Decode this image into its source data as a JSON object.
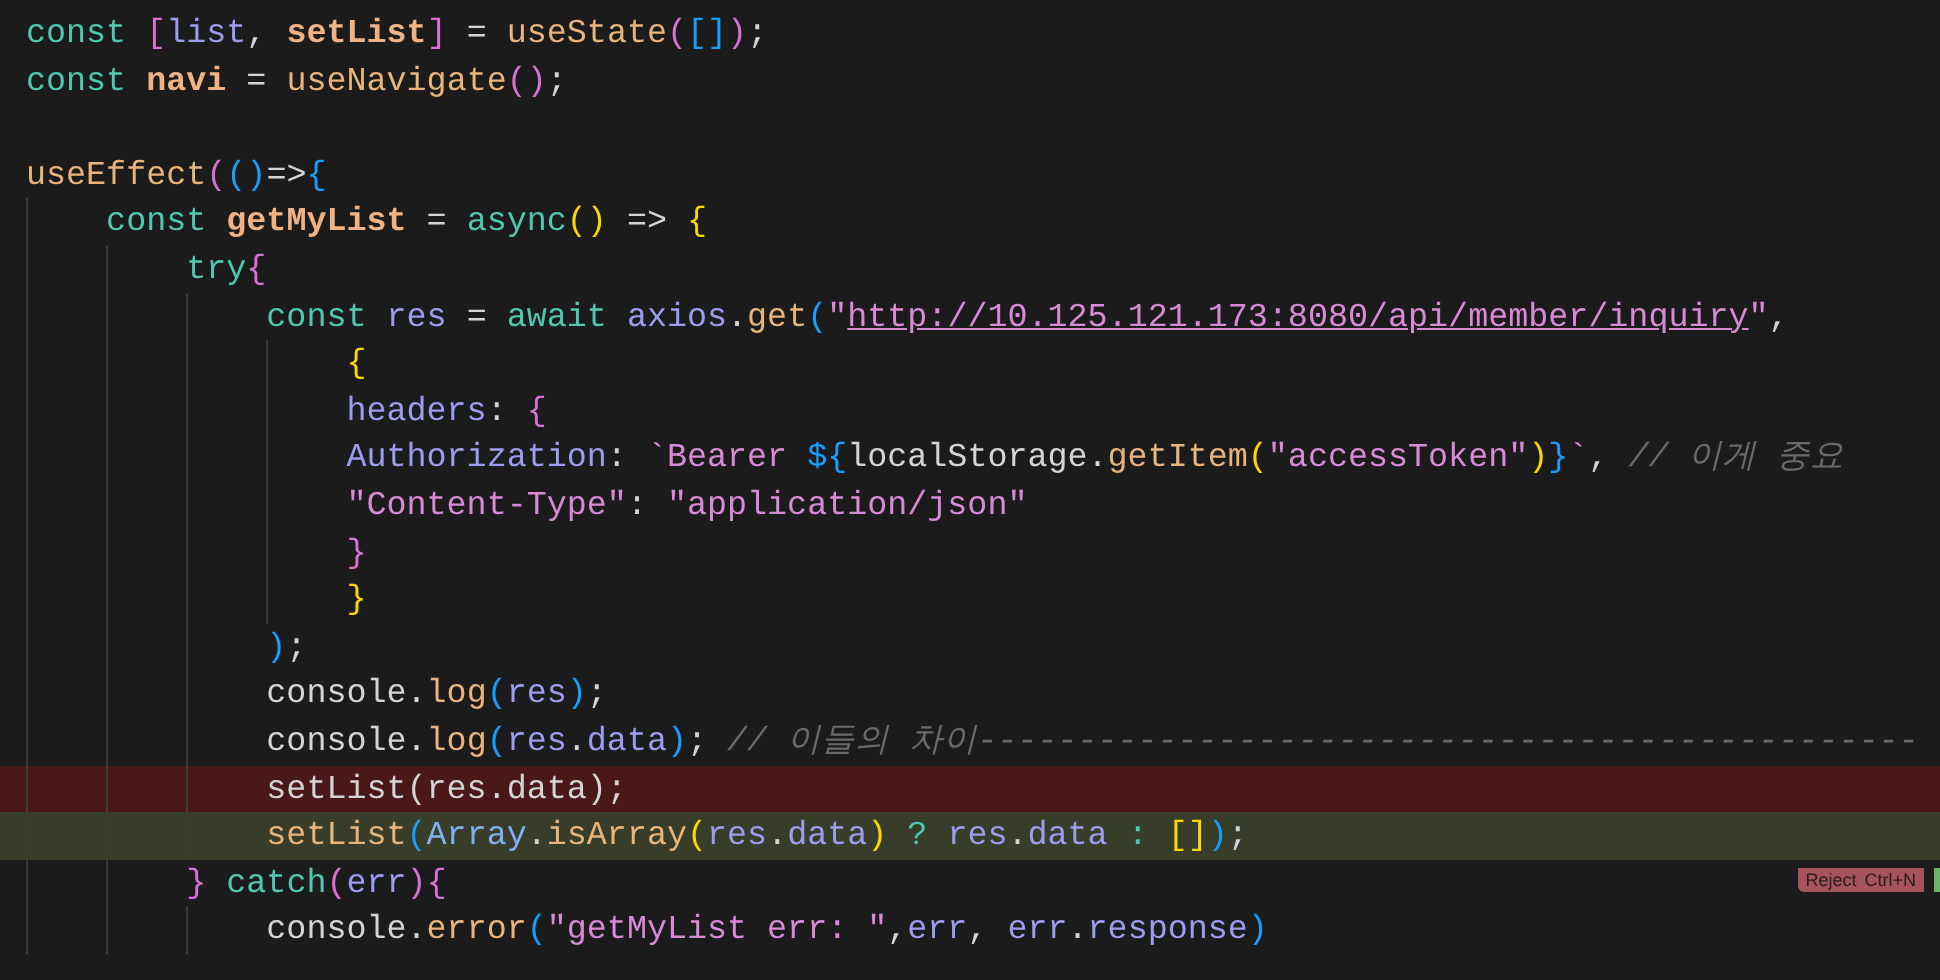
{
  "editor": {
    "lines": [
      {
        "kind": "code",
        "tokens": [
          {
            "t": "const ",
            "kind": "kw"
          },
          {
            "t": "[",
            "kind": "pink"
          },
          {
            "t": "list",
            "kind": "var"
          },
          {
            "t": ", ",
            "kind": "punc"
          },
          {
            "t": "setList",
            "kind": "fnb"
          },
          {
            "t": "]",
            "kind": "pink"
          },
          {
            "t": " = ",
            "kind": "punc"
          },
          {
            "t": "useState",
            "kind": "fn"
          },
          {
            "t": "(",
            "kind": "pink"
          },
          {
            "t": "[]",
            "kind": "blue"
          },
          {
            "t": ")",
            "kind": "pink"
          },
          {
            "t": ";",
            "kind": "punc"
          }
        ]
      },
      {
        "kind": "code",
        "tokens": [
          {
            "t": "const ",
            "kind": "kw"
          },
          {
            "t": "navi",
            "kind": "fnb"
          },
          {
            "t": " = ",
            "kind": "punc"
          },
          {
            "t": "useNavigate",
            "kind": "fn"
          },
          {
            "t": "()",
            "kind": "pink"
          },
          {
            "t": ";",
            "kind": "punc"
          }
        ]
      },
      {
        "kind": "blank"
      },
      {
        "kind": "code",
        "tokens": [
          {
            "t": "useEffect",
            "kind": "fn"
          },
          {
            "t": "(",
            "kind": "pink"
          },
          {
            "t": "()",
            "kind": "blue"
          },
          {
            "t": "=>",
            "kind": "punc"
          },
          {
            "t": "{",
            "kind": "blue"
          }
        ]
      },
      {
        "kind": "code",
        "tokens": [
          {
            "t": "    const ",
            "kind": "kw"
          },
          {
            "t": "getMyList",
            "kind": "fnb"
          },
          {
            "t": " = ",
            "kind": "punc"
          },
          {
            "t": "async",
            "kind": "kw"
          },
          {
            "t": "()",
            "kind": "yellow"
          },
          {
            "t": " => ",
            "kind": "punc"
          },
          {
            "t": "{",
            "kind": "yellow"
          }
        ]
      },
      {
        "kind": "code",
        "tokens": [
          {
            "t": "        try",
            "kind": "kw"
          },
          {
            "t": "{",
            "kind": "pink"
          }
        ]
      },
      {
        "kind": "code",
        "tokens": [
          {
            "t": "            const",
            "kind": "kw"
          },
          {
            "t": " res",
            "kind": "var"
          },
          {
            "t": " = ",
            "kind": "punc"
          },
          {
            "t": "await",
            "kind": "kw"
          },
          {
            "t": " axios",
            "kind": "var"
          },
          {
            "t": ".",
            "kind": "punc"
          },
          {
            "t": "get",
            "kind": "fn"
          },
          {
            "t": "(",
            "kind": "blue"
          },
          {
            "t": "\"",
            "kind": "str"
          },
          {
            "t": "http://10.125.121.173:8080/api/member/inquiry",
            "kind": "url"
          },
          {
            "t": "\"",
            "kind": "str"
          },
          {
            "t": ",",
            "kind": "punc"
          }
        ]
      },
      {
        "kind": "code",
        "tokens": [
          {
            "t": "                {",
            "kind": "yellow"
          }
        ]
      },
      {
        "kind": "code",
        "tokens": [
          {
            "t": "                headers",
            "kind": "var"
          },
          {
            "t": ": ",
            "kind": "punc"
          },
          {
            "t": "{",
            "kind": "pink"
          }
        ]
      },
      {
        "kind": "code",
        "tokens": [
          {
            "t": "                Authorization",
            "kind": "var"
          },
          {
            "t": ": ",
            "kind": "punc"
          },
          {
            "t": "`Bearer ",
            "kind": "str"
          },
          {
            "t": "${",
            "kind": "blue"
          },
          {
            "t": "localStorage",
            "kind": "plain"
          },
          {
            "t": ".",
            "kind": "punc"
          },
          {
            "t": "getItem",
            "kind": "fn"
          },
          {
            "t": "(",
            "kind": "yellow"
          },
          {
            "t": "\"accessToken\"",
            "kind": "str"
          },
          {
            "t": ")",
            "kind": "yellow"
          },
          {
            "t": "}",
            "kind": "blue"
          },
          {
            "t": "`",
            "kind": "str"
          },
          {
            "t": ", ",
            "kind": "punc"
          },
          {
            "t": "// 이게 중요",
            "kind": "comment"
          }
        ]
      },
      {
        "kind": "code",
        "tokens": [
          {
            "t": "                \"Content-Type\"",
            "kind": "str"
          },
          {
            "t": ": ",
            "kind": "punc"
          },
          {
            "t": "\"application/json\"",
            "kind": "str"
          }
        ]
      },
      {
        "kind": "code",
        "tokens": [
          {
            "t": "                }",
            "kind": "pink"
          }
        ]
      },
      {
        "kind": "code",
        "tokens": [
          {
            "t": "                }",
            "kind": "yellow"
          }
        ]
      },
      {
        "kind": "code",
        "tokens": [
          {
            "t": "            )",
            "kind": "blue"
          },
          {
            "t": ";",
            "kind": "punc"
          }
        ]
      },
      {
        "kind": "code",
        "tokens": [
          {
            "t": "            console",
            "kind": "plain"
          },
          {
            "t": ".",
            "kind": "punc"
          },
          {
            "t": "log",
            "kind": "fn"
          },
          {
            "t": "(",
            "kind": "blue"
          },
          {
            "t": "res",
            "kind": "var"
          },
          {
            "t": ")",
            "kind": "blue"
          },
          {
            "t": ";",
            "kind": "punc"
          }
        ]
      },
      {
        "kind": "code",
        "tokens": [
          {
            "t": "            console",
            "kind": "plain"
          },
          {
            "t": ".",
            "kind": "punc"
          },
          {
            "t": "log",
            "kind": "fn"
          },
          {
            "t": "(",
            "kind": "blue"
          },
          {
            "t": "res",
            "kind": "var"
          },
          {
            "t": ".",
            "kind": "punc"
          },
          {
            "t": "data",
            "kind": "var"
          },
          {
            "t": ")",
            "kind": "blue"
          },
          {
            "t": "; ",
            "kind": "punc"
          },
          {
            "t": "// 이들의 차이-----------------------------------------------",
            "kind": "comment"
          }
        ]
      },
      {
        "kind": "removed",
        "tokens": [
          {
            "t": "            setList(res.data);",
            "kind": "plain"
          }
        ]
      },
      {
        "kind": "added",
        "tokens": [
          {
            "t": "            setList",
            "kind": "fn"
          },
          {
            "t": "(",
            "kind": "blue"
          },
          {
            "t": "Array",
            "kind": "cls"
          },
          {
            "t": ".",
            "kind": "punc"
          },
          {
            "t": "isArray",
            "kind": "fn"
          },
          {
            "t": "(",
            "kind": "yellow"
          },
          {
            "t": "res",
            "kind": "var"
          },
          {
            "t": ".",
            "kind": "punc"
          },
          {
            "t": "data",
            "kind": "var"
          },
          {
            "t": ")",
            "kind": "yellow"
          },
          {
            "t": " ? ",
            "kind": "kw"
          },
          {
            "t": "res",
            "kind": "var"
          },
          {
            "t": ".",
            "kind": "punc"
          },
          {
            "t": "data",
            "kind": "var"
          },
          {
            "t": " : ",
            "kind": "kw"
          },
          {
            "t": "[]",
            "kind": "yellow"
          },
          {
            "t": ")",
            "kind": "blue"
          },
          {
            "t": ";",
            "kind": "punc"
          }
        ]
      },
      {
        "kind": "code",
        "tokens": [
          {
            "t": "        }",
            "kind": "pink"
          },
          {
            "t": " catch",
            "kind": "kw"
          },
          {
            "t": "(",
            "kind": "pink"
          },
          {
            "t": "err",
            "kind": "var"
          },
          {
            "t": ")",
            "kind": "pink"
          },
          {
            "t": "{",
            "kind": "pink"
          }
        ]
      },
      {
        "kind": "code",
        "tokens": [
          {
            "t": "            console",
            "kind": "plain"
          },
          {
            "t": ".",
            "kind": "punc"
          },
          {
            "t": "error",
            "kind": "fn"
          },
          {
            "t": "(",
            "kind": "blue"
          },
          {
            "t": "\"getMyList err: \"",
            "kind": "str"
          },
          {
            "t": ",",
            "kind": "punc"
          },
          {
            "t": "err",
            "kind": "var"
          },
          {
            "t": ", ",
            "kind": "punc"
          },
          {
            "t": "err",
            "kind": "var"
          },
          {
            "t": ".",
            "kind": "punc"
          },
          {
            "t": "response",
            "kind": "var"
          },
          {
            "t": ")",
            "kind": "blue"
          }
        ]
      }
    ],
    "reject_button": {
      "label": "Reject",
      "shortcut": "Ctrl+N"
    }
  }
}
